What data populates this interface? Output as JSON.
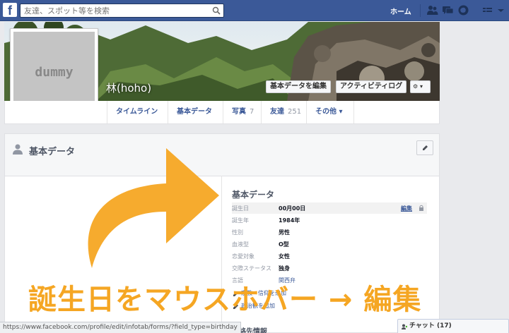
{
  "topbar": {
    "logo": "f",
    "search_placeholder": "友達、スポット等を検索",
    "home": "ホーム",
    "icons": [
      "friends-icon",
      "messages-icon",
      "notifications-icon",
      "settings-icon"
    ]
  },
  "profile": {
    "picture_text": "dummy",
    "name": "林(hoho)",
    "update_info_button": "基本データを編集",
    "activity_log_button": "アクティビティログ",
    "settings_button": "⚙ ▾"
  },
  "tabs": [
    {
      "label": "タイムライン",
      "count": ""
    },
    {
      "label": "基本データ",
      "count": ""
    },
    {
      "label": "写真",
      "count": "7"
    },
    {
      "label": "友達",
      "count": "251"
    },
    {
      "label": "その他 ▾",
      "count": ""
    }
  ],
  "about": {
    "header": "基本データ",
    "section_title": "基本データ",
    "rows": [
      {
        "label": "誕生日",
        "value": "00月00日"
      },
      {
        "label": "誕生年",
        "value": "1984年"
      },
      {
        "label": "性別",
        "value": "男性"
      },
      {
        "label": "血液型",
        "value": "O型"
      },
      {
        "label": "恋愛対象",
        "value": "女性"
      },
      {
        "label": "交際ステータス",
        "value": "独身"
      },
      {
        "label": "言語",
        "value": "関西弁"
      }
    ],
    "edit_link": "編集",
    "add_religion": "宗教・信仰を追加",
    "add_politics": "政治観を追加",
    "next_section": "連絡先情報"
  },
  "overlay": {
    "caption": "誕生日をマウスホバー → 編集",
    "accent_color": "#f5a623"
  },
  "status_bar": {
    "url": "https://www.facebook.com/profile/edit/infotab/forms/?field_type=birthday"
  },
  "chat": {
    "label": "チャット (17)"
  }
}
